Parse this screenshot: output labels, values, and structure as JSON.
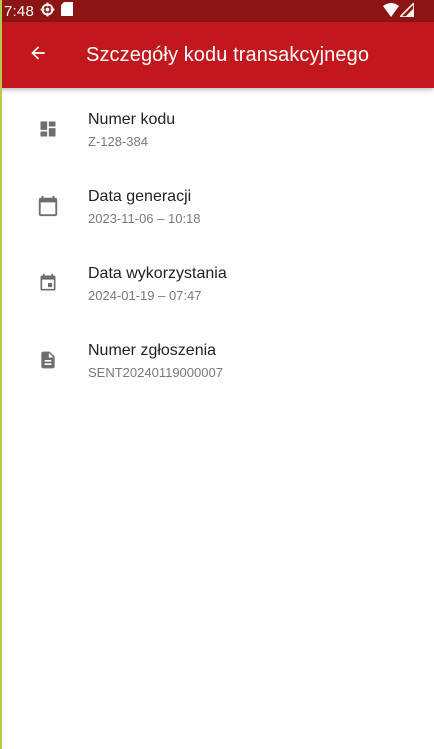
{
  "status_bar": {
    "time": "7:48",
    "icons": [
      "settings-icon",
      "sd-card-icon",
      "wifi-icon",
      "signal-icon"
    ],
    "color": "#8c1414"
  },
  "app_bar": {
    "back_icon": "arrow-back-icon",
    "title": "Szczegóły kodu transakcyjnego",
    "color": "#c2171c"
  },
  "details": [
    {
      "icon": "dashboard-icon",
      "label": "Numer kodu",
      "value": "Z-128-384"
    },
    {
      "icon": "calendar-icon",
      "label": "Data generacji",
      "value": "2023-11-06 – 10:18"
    },
    {
      "icon": "event-icon",
      "label": "Data wykorzystania",
      "value": "2024-01-19 – 07:47"
    },
    {
      "icon": "document-icon",
      "label": "Numer zgłoszenia",
      "value": "SENT20240119000007"
    }
  ]
}
